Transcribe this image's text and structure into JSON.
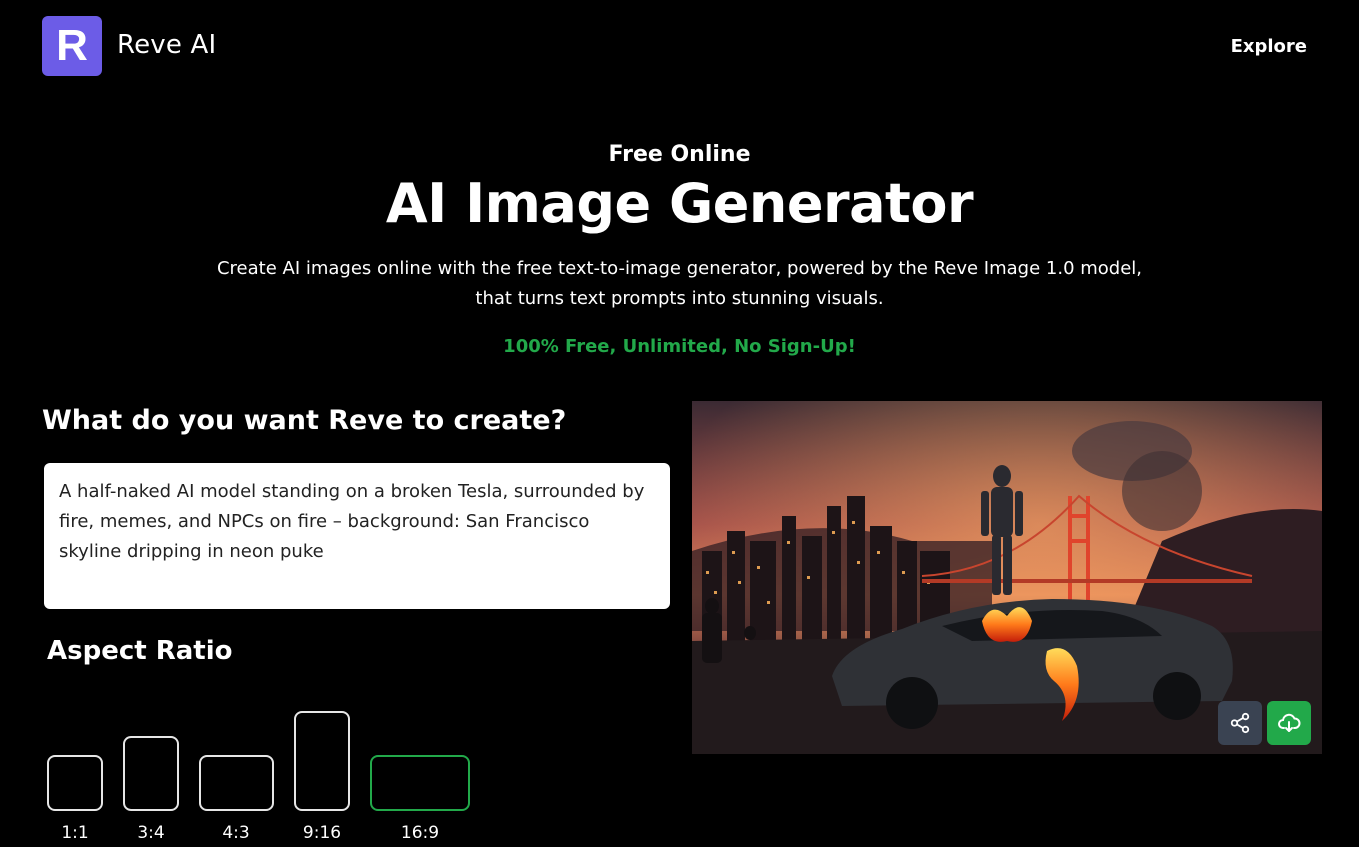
{
  "header": {
    "logo_letter": "R",
    "brand": "Reve AI",
    "nav_explore": "Explore"
  },
  "hero": {
    "kicker": "Free Online",
    "title": "AI Image Generator",
    "description": "Create AI images online with the free text-to-image generator, powered by the Reve Image 1.0 model, that turns text prompts into stunning visuals.",
    "free_tag": "100% Free, Unlimited, No Sign-Up!"
  },
  "form": {
    "prompt_heading": "What do you want Reve to create?",
    "prompt_value": "A half-naked AI model standing on a broken Tesla, surrounded by fire, memes, and NPCs on fire – background: San Francisco skyline dripping in neon puke",
    "aspect_heading": "Aspect Ratio",
    "ratios": [
      {
        "label": "1:1",
        "selected": false
      },
      {
        "label": "3:4",
        "selected": false
      },
      {
        "label": "4:3",
        "selected": false
      },
      {
        "label": "9:16",
        "selected": false
      },
      {
        "label": "16:9",
        "selected": true
      }
    ]
  },
  "preview": {
    "icons": {
      "share": "share-icon",
      "download": "cloud-download-icon"
    }
  },
  "colors": {
    "brand": "#6c5ce7",
    "accent_green": "#22a94a",
    "share_button": "#3a4352"
  }
}
